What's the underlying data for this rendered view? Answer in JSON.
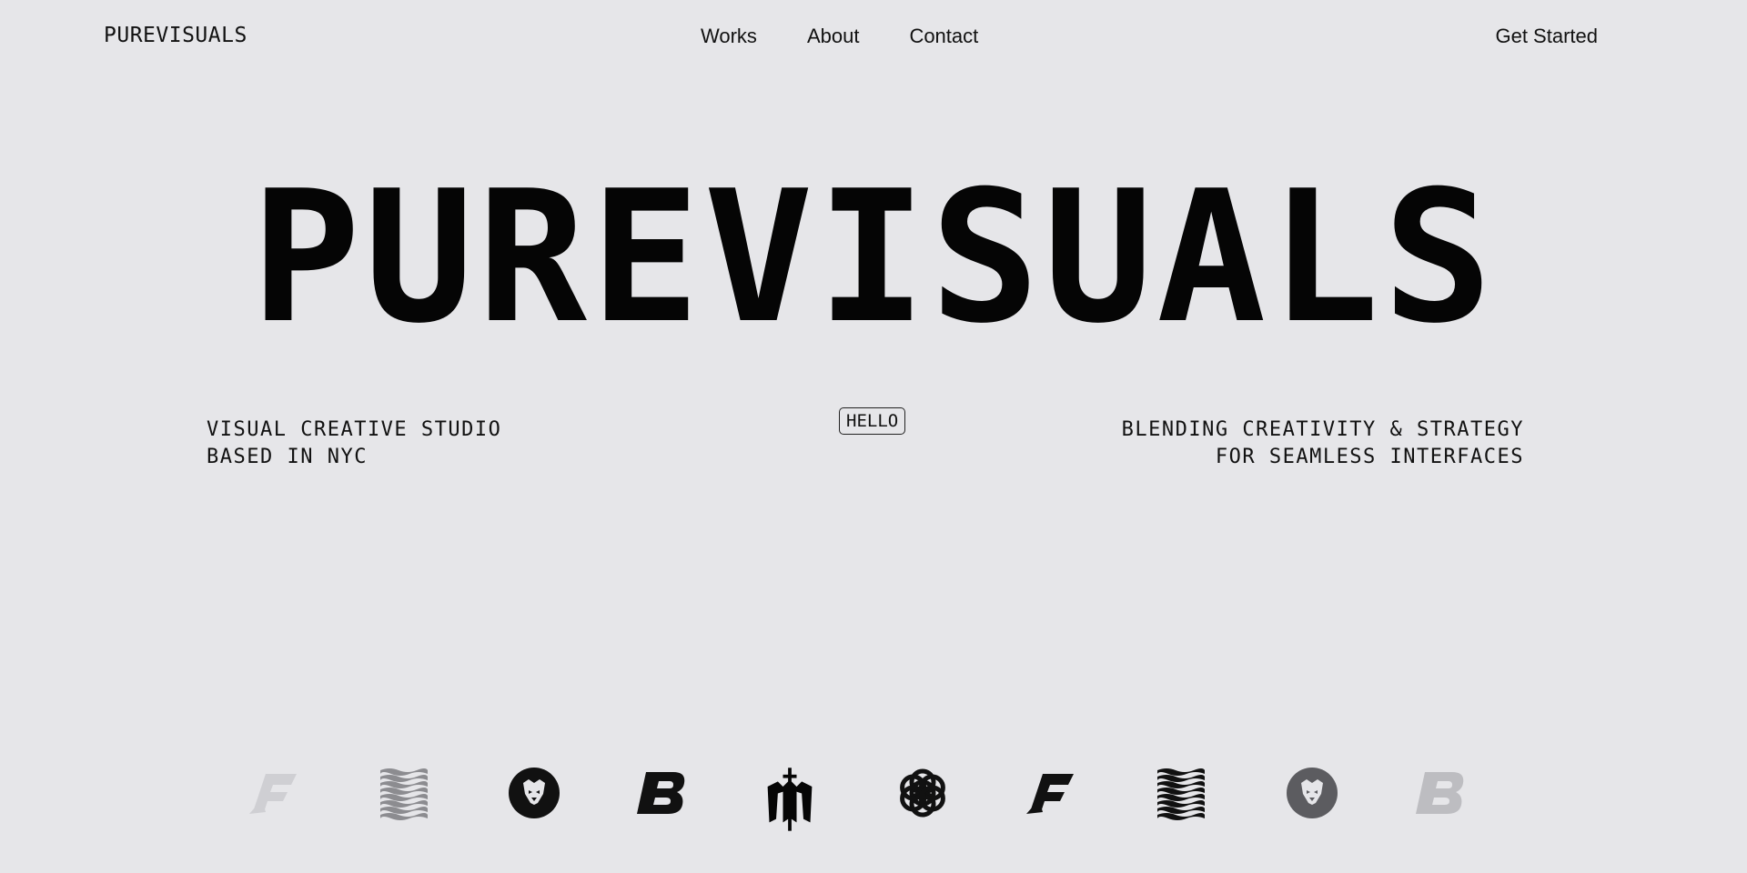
{
  "nav": {
    "brand": "PUREVISUALS",
    "links": [
      "Works",
      "About",
      "Contact"
    ],
    "cta": "Get Started"
  },
  "hero": {
    "title": "PUREVISUALS",
    "tagline_left": "VISUAL CREATIVE STUDIO\nBASED IN NYC",
    "badge": "HELLO",
    "tagline_right": "BLENDING CREATIVITY & STRATEGY\nFOR SEAMLESS INTERFACES"
  },
  "colors": {
    "background": "#e6e6e9",
    "text": "#0a0a0a"
  },
  "logos": [
    {
      "icon": "f-monogram-icon",
      "shade": "#cfcfd3"
    },
    {
      "icon": "wave-pattern-icon",
      "shade": "#8c8c90"
    },
    {
      "icon": "lion-badge-icon",
      "shade": "#111111"
    },
    {
      "icon": "b-monogram-icon",
      "shade": "#111111"
    },
    {
      "icon": "gothic-m-sword-icon",
      "shade": "#050505"
    },
    {
      "icon": "flower-of-life-icon",
      "shade": "#111111"
    },
    {
      "icon": "f-monogram-icon",
      "shade": "#111111"
    },
    {
      "icon": "wave-pattern-icon",
      "shade": "#111111"
    },
    {
      "icon": "lion-badge-icon",
      "shade": "#5c5c60"
    },
    {
      "icon": "b-monogram-icon",
      "shade": "#bdbdc1"
    }
  ]
}
